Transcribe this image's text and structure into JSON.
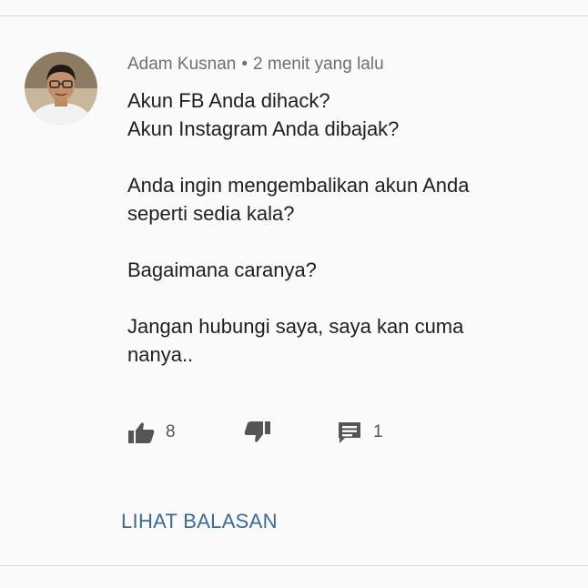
{
  "comment": {
    "author": "Adam Kusnan",
    "separator": "•",
    "time": "2 menit yang lalu",
    "paragraphs": [
      [
        "Akun FB Anda dihack?",
        "Akun Instagram Anda dibajak?"
      ],
      [
        "Anda ingin mengembalikan akun Anda",
        "seperti sedia kala?"
      ],
      [
        "Bagaimana caranya?"
      ],
      [
        "Jangan hubungi saya, saya kan cuma",
        "nanya.."
      ]
    ],
    "like_icon": "thumbs-up-icon",
    "like_count": "8",
    "dislike_icon": "thumbs-down-icon",
    "reply_icon": "comment-icon",
    "reply_count": "1",
    "view_replies_label": "LIHAT BALASAN"
  },
  "colors": {
    "background": "#fafafa",
    "link": "#3a6a9a",
    "meta_text": "#6f6f6f",
    "body_text": "#1f1f1f",
    "icon": "#555555"
  }
}
